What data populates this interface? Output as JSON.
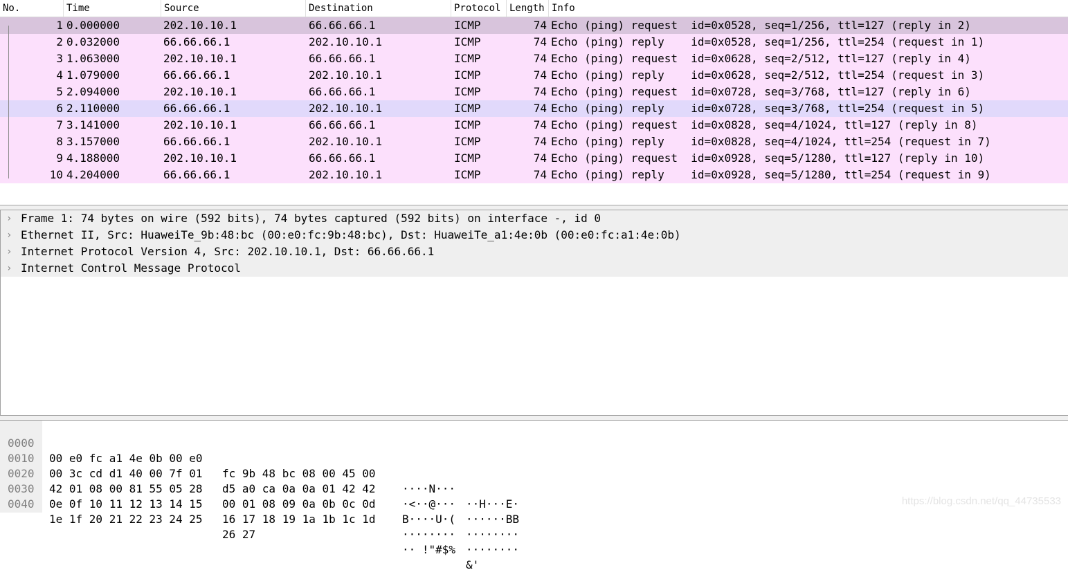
{
  "packet_list": {
    "columns": [
      "No.",
      "Time",
      "Source",
      "Destination",
      "Protocol",
      "Length",
      "Info"
    ],
    "rows": [
      {
        "no": "1",
        "time": "0.000000",
        "src": "202.10.10.1",
        "dst": "66.66.66.1",
        "proto": "ICMP",
        "len": "74",
        "info": "Echo (ping) request  id=0x0528, seq=1/256, ttl=127 (reply in 2)"
      },
      {
        "no": "2",
        "time": "0.032000",
        "src": "66.66.66.1",
        "dst": "202.10.10.1",
        "proto": "ICMP",
        "len": "74",
        "info": "Echo (ping) reply    id=0x0528, seq=1/256, ttl=254 (request in 1)"
      },
      {
        "no": "3",
        "time": "1.063000",
        "src": "202.10.10.1",
        "dst": "66.66.66.1",
        "proto": "ICMP",
        "len": "74",
        "info": "Echo (ping) request  id=0x0628, seq=2/512, ttl=127 (reply in 4)"
      },
      {
        "no": "4",
        "time": "1.079000",
        "src": "66.66.66.1",
        "dst": "202.10.10.1",
        "proto": "ICMP",
        "len": "74",
        "info": "Echo (ping) reply    id=0x0628, seq=2/512, ttl=254 (request in 3)"
      },
      {
        "no": "5",
        "time": "2.094000",
        "src": "202.10.10.1",
        "dst": "66.66.66.1",
        "proto": "ICMP",
        "len": "74",
        "info": "Echo (ping) request  id=0x0728, seq=3/768, ttl=127 (reply in 6)"
      },
      {
        "no": "6",
        "time": "2.110000",
        "src": "66.66.66.1",
        "dst": "202.10.10.1",
        "proto": "ICMP",
        "len": "74",
        "info": "Echo (ping) reply    id=0x0728, seq=3/768, ttl=254 (request in 5)"
      },
      {
        "no": "7",
        "time": "3.141000",
        "src": "202.10.10.1",
        "dst": "66.66.66.1",
        "proto": "ICMP",
        "len": "74",
        "info": "Echo (ping) request  id=0x0828, seq=4/1024, ttl=127 (reply in 8)"
      },
      {
        "no": "8",
        "time": "3.157000",
        "src": "66.66.66.1",
        "dst": "202.10.10.1",
        "proto": "ICMP",
        "len": "74",
        "info": "Echo (ping) reply    id=0x0828, seq=4/1024, ttl=254 (request in 7)"
      },
      {
        "no": "9",
        "time": "4.188000",
        "src": "202.10.10.1",
        "dst": "66.66.66.1",
        "proto": "ICMP",
        "len": "74",
        "info": "Echo (ping) request  id=0x0928, seq=5/1280, ttl=127 (reply in 10)"
      },
      {
        "no": "10",
        "time": "4.204000",
        "src": "66.66.66.1",
        "dst": "202.10.10.1",
        "proto": "ICMP",
        "len": "74",
        "info": "Echo (ping) reply    id=0x0928, seq=5/1280, ttl=254 (request in 9)"
      }
    ]
  },
  "details": {
    "items": [
      {
        "label": "Frame 1: 74 bytes on wire (592 bits), 74 bytes captured (592 bits) on interface -, id 0",
        "icon": "chevron-right-icon"
      },
      {
        "label": "Ethernet II, Src: HuaweiTe_9b:48:bc (00:e0:fc:9b:48:bc), Dst: HuaweiTe_a1:4e:0b (00:e0:fc:a1:4e:0b)",
        "icon": "chevron-right-icon"
      },
      {
        "label": "Internet Protocol Version 4, Src: 202.10.10.1, Dst: 66.66.66.1",
        "icon": "chevron-right-icon"
      },
      {
        "label": "Internet Control Message Protocol",
        "icon": "chevron-right-icon"
      }
    ]
  },
  "bytes": {
    "rows": [
      {
        "offset": "0000",
        "hex1": "00 e0 fc a1 4e 0b 00 e0",
        "hex2": "fc 9b 48 bc 08 00 45 00",
        "ascii1": "····N···",
        "ascii2": "··H···E·"
      },
      {
        "offset": "0010",
        "hex1": "00 3c cd d1 40 00 7f 01",
        "hex2": "d5 a0 ca 0a 0a 01 42 42",
        "ascii1": "·<··@···",
        "ascii2": "······BB"
      },
      {
        "offset": "0020",
        "hex1": "42 01 08 00 81 55 05 28",
        "hex2": "00 01 08 09 0a 0b 0c 0d",
        "ascii1": "B····U·(",
        "ascii2": "········"
      },
      {
        "offset": "0030",
        "hex1": "0e 0f 10 11 12 13 14 15",
        "hex2": "16 17 18 19 1a 1b 1c 1d",
        "ascii1": "········",
        "ascii2": "········"
      },
      {
        "offset": "0040",
        "hex1": "1e 1f 20 21 22 23 24 25",
        "hex2": "26 27",
        "ascii1": "·· !\"#$%",
        "ascii2": "&'"
      }
    ]
  },
  "watermark": "https://blog.csdn.net/qq_44735533",
  "colors": {
    "icmp_row": "#fce0fc",
    "selected_row": "#d8c4dc",
    "related_row": "#e1d9fb"
  }
}
